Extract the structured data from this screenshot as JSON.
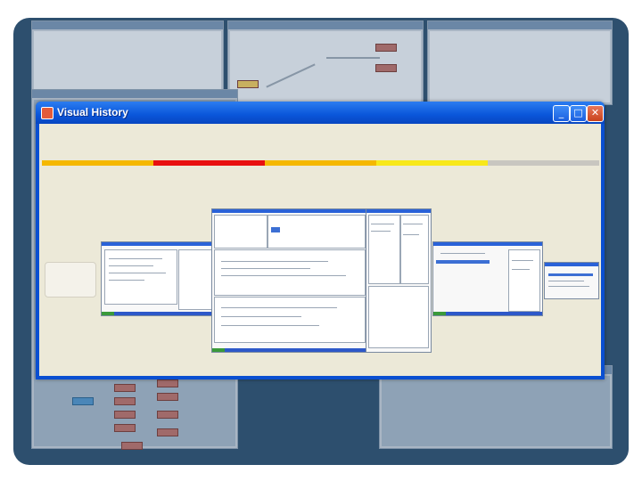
{
  "window": {
    "title": "Visual History",
    "icon": "java-app-icon",
    "controls": {
      "minimize": "_",
      "maximize": "□",
      "close": "✕"
    }
  },
  "timeline": {
    "segments": [
      {
        "color": "#f5b800"
      },
      {
        "color": "#e81010"
      },
      {
        "color": "#f5b800"
      },
      {
        "color": "#f8e81a"
      },
      {
        "color": "#c8c6c0"
      }
    ]
  },
  "thumbnails": [
    {
      "name": "history-thumbnail-empty"
    },
    {
      "name": "history-thumbnail-1"
    },
    {
      "name": "history-thumbnail-2"
    },
    {
      "name": "history-thumbnail-3"
    },
    {
      "name": "history-thumbnail-4"
    },
    {
      "name": "history-thumbnail-5"
    }
  ]
}
